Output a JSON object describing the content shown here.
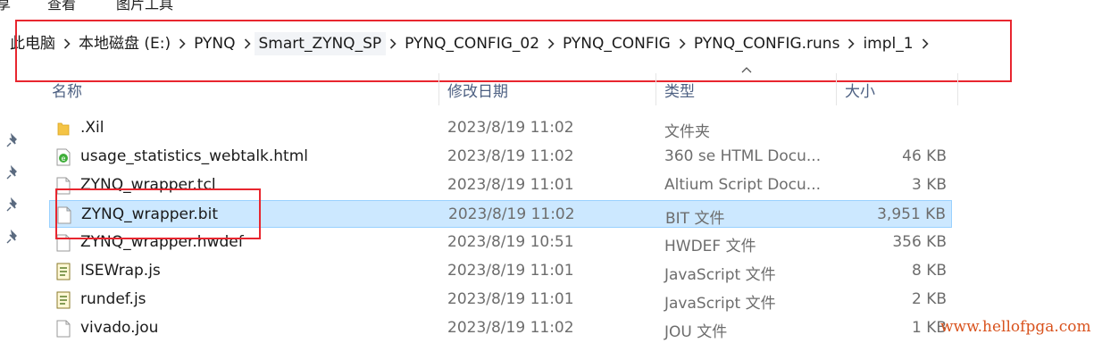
{
  "ribbon": {
    "tabs": [
      "享",
      "查看",
      "图片工具"
    ]
  },
  "breadcrumb": [
    "此电脑",
    "本地磁盘 (E:)",
    "PYNQ",
    "Smart_ZYNQ_SP",
    "PYNQ_CONFIG_02",
    "PYNQ_CONFIG",
    "PYNQ_CONFIG.runs",
    "impl_1"
  ],
  "columns": {
    "name": "名称",
    "date": "修改日期",
    "type": "类型",
    "size": "大小"
  },
  "files": [
    {
      "icon": "folder-icon",
      "name": ".Xil",
      "date": "2023/8/19 11:02",
      "type": "文件夹",
      "size": ""
    },
    {
      "icon": "html-360-icon",
      "name": "usage_statistics_webtalk.html",
      "date": "2023/8/19 11:02",
      "type": "360 se HTML Docu...",
      "size": "46 KB"
    },
    {
      "icon": "blank-file-icon",
      "name": "ZYNQ_wrapper.tcl",
      "date": "2023/8/19 11:01",
      "type": "Altium Script Docu...",
      "size": "3 KB"
    },
    {
      "icon": "blank-file-icon",
      "name": "ZYNQ_wrapper.bit",
      "date": "2023/8/19 11:02",
      "type": "BIT 文件",
      "size": "3,951 KB"
    },
    {
      "icon": "blank-file-icon",
      "name": "ZYNQ_wrapper.hwdef",
      "date": "2023/8/19 10:51",
      "type": "HWDEF 文件",
      "size": "356 KB"
    },
    {
      "icon": "script-icon",
      "name": "ISEWrap.js",
      "date": "2023/8/19 11:01",
      "type": "JavaScript 文件",
      "size": "8 KB"
    },
    {
      "icon": "script-icon",
      "name": "rundef.js",
      "date": "2023/8/19 11:01",
      "type": "JavaScript 文件",
      "size": "2 KB"
    },
    {
      "icon": "blank-file-icon",
      "name": "vivado.jou",
      "date": "2023/8/19 11:02",
      "type": "JOU 文件",
      "size": "1 KB"
    }
  ],
  "selected_file": "ZYNQ_wrapper.bit",
  "watermark": "www.hellofpga.com",
  "colors": {
    "highlight_box": "#e8262f",
    "selection_bg": "#cce8ff",
    "header_text": "#4d6082"
  }
}
